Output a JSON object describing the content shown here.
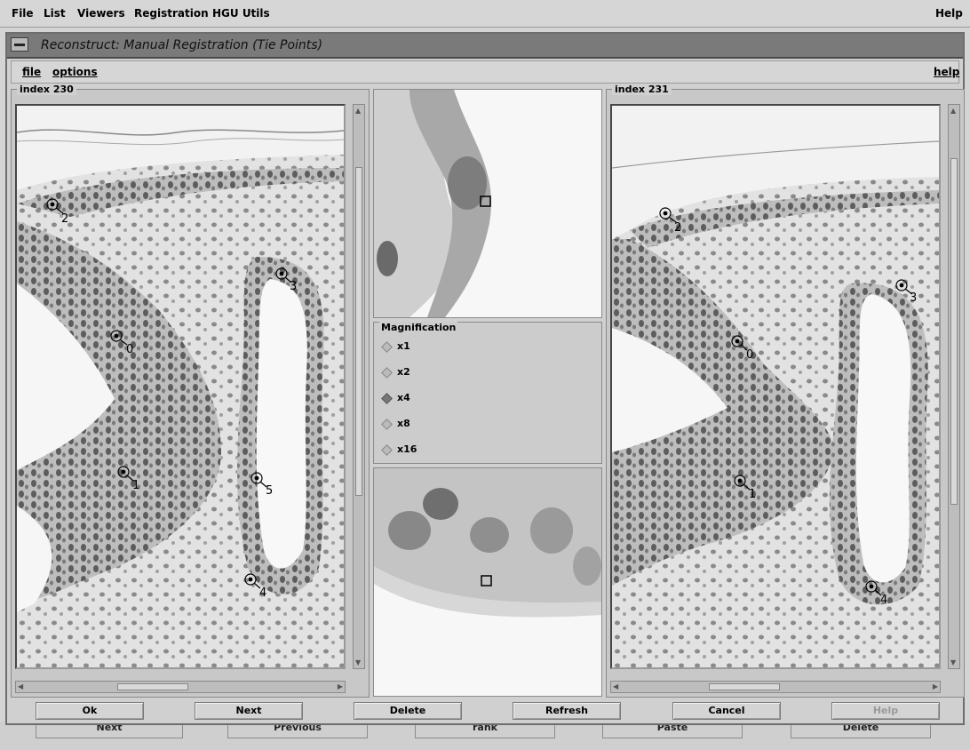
{
  "menubar": {
    "items": [
      "File",
      "List",
      "Viewers",
      "Registration",
      "HGU Utils"
    ],
    "help": "Help"
  },
  "window": {
    "title": "Reconstruct: Manual Registration (Tie Points)"
  },
  "dialog_menu": {
    "file": "file",
    "options": "options",
    "help": "help"
  },
  "left_panel": {
    "label": "index 230",
    "tie_points": [
      "2",
      "3",
      "0",
      "1",
      "5",
      "4"
    ]
  },
  "right_panel": {
    "label": "index 231",
    "tie_points": [
      "2",
      "3",
      "0",
      "1",
      "4"
    ]
  },
  "magnification": {
    "label": "Magnification",
    "options": [
      "x1",
      "x2",
      "x4",
      "x8",
      "x16"
    ],
    "selected": "x4"
  },
  "buttons": {
    "ok": "Ok",
    "next": "Next",
    "delete": "Delete",
    "refresh": "Refresh",
    "cancel": "Cancel",
    "help": "Help"
  },
  "background_buttons": [
    "Next",
    "Previous",
    "rank",
    "Paste",
    "Delete"
  ]
}
